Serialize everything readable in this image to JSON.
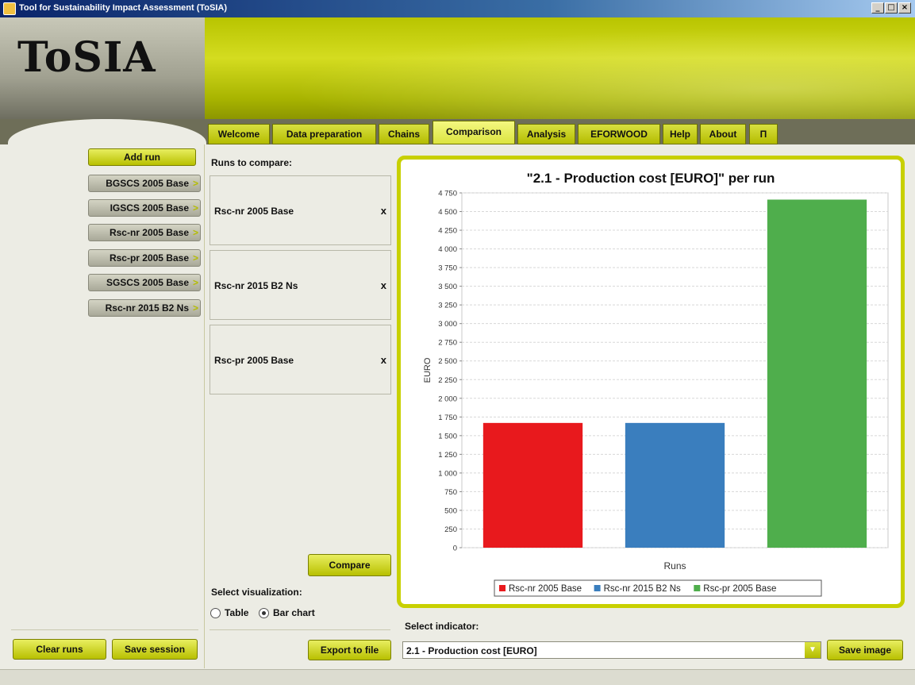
{
  "window": {
    "title": "Tool for Sustainability Impact Assessment (ToSIA)",
    "min": "_",
    "max": "□",
    "close": "×"
  },
  "logo": {
    "text": "ToSIA"
  },
  "tabs": [
    {
      "label": "Welcome",
      "active": false
    },
    {
      "label": "Data preparation",
      "active": false
    },
    {
      "label": "Chains",
      "active": false
    },
    {
      "label": "Comparison",
      "active": true
    },
    {
      "label": "Analysis",
      "active": false
    },
    {
      "label": "EFORWOOD",
      "active": false
    },
    {
      "label": "Help",
      "active": false
    },
    {
      "label": "About",
      "active": false
    },
    {
      "label": "Π",
      "active": false
    }
  ],
  "sidebar": {
    "add_run": "Add run",
    "runs": [
      "BGSCS 2005 Base",
      "IGSCS 2005 Base",
      "Rsc-nr 2005 Base",
      "Rsc-pr 2005 Base",
      "SGSCS 2005 Base",
      "Rsc-nr 2015 B2 Ns"
    ],
    "arrow": ">",
    "clear_runs": "Clear runs",
    "save_session": "Save session"
  },
  "compare": {
    "heading": "Runs to compare:",
    "items": [
      "Rsc-nr 2005 Base",
      "Rsc-nr 2015 B2 Ns",
      "Rsc-pr 2005 Base"
    ],
    "remove": "x",
    "compare_button": "Compare",
    "visualization_label": "Select visualization:",
    "option_table": "Table",
    "option_bar": "Bar chart",
    "selected_visualization": "Bar chart",
    "export_button": "Export to file"
  },
  "indicator": {
    "label": "Select indicator:",
    "selected": "2.1 - Production cost [EURO]",
    "dropdown_icon": "chevron-down-icon",
    "save_image": "Save image"
  },
  "chart_data": {
    "type": "bar",
    "title": "\"2.1 - Production cost [EURO]\" per run",
    "xlabel": "Runs",
    "ylabel": "EURO",
    "ylim": [
      0,
      4750
    ],
    "yticks": [
      "0",
      "250",
      "500",
      "750",
      "1 000",
      "1 250",
      "1 500",
      "1 750",
      "2 000",
      "2 250",
      "2 500",
      "2 750",
      "3 000",
      "3 250",
      "3 500",
      "3 750",
      "4 000",
      "4 250",
      "4 500",
      "4 750"
    ],
    "grid": true,
    "legend_position": "bottom",
    "series": [
      {
        "name": "Rsc-nr 2005 Base",
        "value": 1670,
        "color": "#e8191d"
      },
      {
        "name": "Rsc-nr 2015 B2 Ns",
        "value": 1670,
        "color": "#3a7ebe"
      },
      {
        "name": "Rsc-pr 2005 Base",
        "value": 4660,
        "color": "#4fae4c"
      }
    ]
  }
}
